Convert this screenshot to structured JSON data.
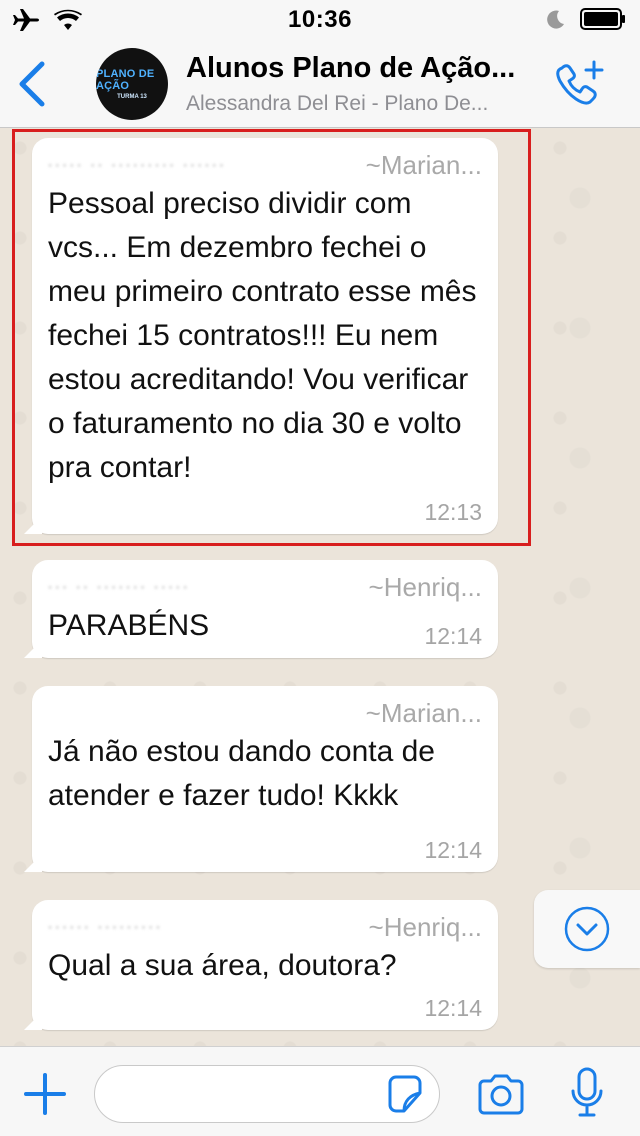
{
  "status_bar": {
    "time": "10:36",
    "icons": [
      "airplane-icon",
      "wifi-icon",
      "moon-icon",
      "battery-icon"
    ]
  },
  "header": {
    "back_icon": "chevron-left-icon",
    "avatar_line1": "PLANO DE AÇÃO",
    "avatar_line2": "TURMA 13",
    "title": "Alunos Plano de Ação...",
    "subtitle": "Alessandra Del Rei - Plano De...",
    "call_icon": "phone-plus-icon"
  },
  "messages": [
    {
      "sender": "~Marian...",
      "text": "Pessoal preciso dividir com vcs... Em dezembro fechei o meu primeiro contrato esse mês fechei 15 contratos!!! Eu nem estou acreditando! Vou verificar o faturamento no dia 30 e volto pra contar!",
      "time": "12:13",
      "highlighted": true
    },
    {
      "sender": "~Henriq...",
      "text": "PARABÉNS",
      "time": "12:14"
    },
    {
      "sender": "~Marian...",
      "text": "Já não estou dando conta de atender e fazer tudo! Kkkk",
      "time": "12:14"
    },
    {
      "sender": "~Henriq...",
      "text": "Qual a sua área, doutora?",
      "time": "12:14"
    }
  ],
  "composer": {
    "plus_icon": "plus-icon",
    "input_value": "",
    "sticker_icon": "sticker-icon",
    "camera_icon": "camera-icon",
    "mic_icon": "microphone-icon"
  },
  "scroll_icon": "chevron-down-circle-icon",
  "colors": {
    "accent": "#1a7ee8",
    "highlight": "#d81e1e"
  }
}
